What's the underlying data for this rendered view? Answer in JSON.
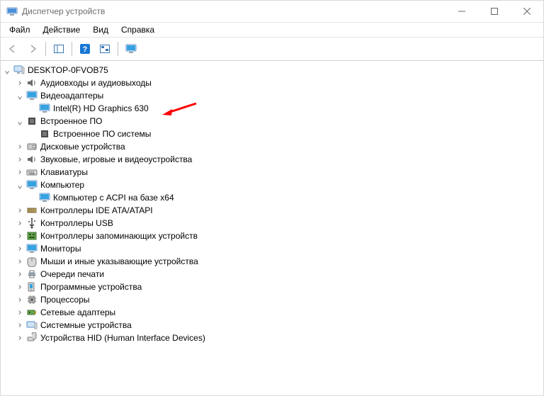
{
  "window": {
    "title": "Диспетчер устройств"
  },
  "menu": {
    "file": "Файл",
    "action": "Действие",
    "view": "Вид",
    "help": "Справка"
  },
  "tree": {
    "root": "DESKTOP-0FVOB75",
    "audio": "Аудиовходы и аудиовыходы",
    "video": "Видеоадаптеры",
    "video_child": "Intel(R) HD Graphics 630",
    "firmware": "Встроенное ПО",
    "firmware_child": "Встроенное ПО системы",
    "disk": "Дисковые устройства",
    "sound": "Звуковые, игровые и видеоустройства",
    "keyboard": "Клавиатуры",
    "computer": "Компьютер",
    "computer_child": "Компьютер с ACPI на базе x64",
    "ide": "Контроллеры IDE ATA/ATAPI",
    "usb": "Контроллеры USB",
    "storage": "Контроллеры запоминающих устройств",
    "monitor": "Мониторы",
    "mouse": "Мыши и иные указывающие устройства",
    "printq": "Очереди печати",
    "software": "Программные устройства",
    "cpu": "Процессоры",
    "net": "Сетевые адаптеры",
    "sysdev": "Системные устройства",
    "hid": "Устройства HID (Human Interface Devices)"
  },
  "colors": {
    "arrow": "#ff0000"
  }
}
